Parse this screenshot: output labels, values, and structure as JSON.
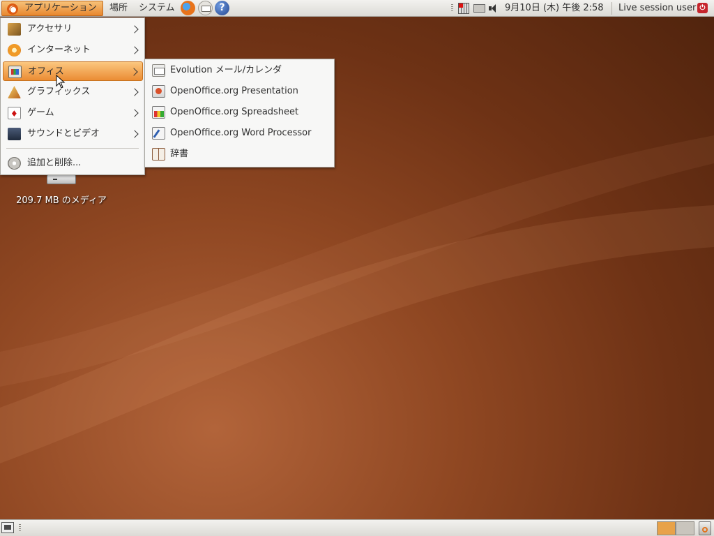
{
  "top_panel": {
    "applications_label": "アプリケーション",
    "places_label": "場所",
    "system_label": "システム",
    "help_glyph": "?",
    "clock": "9月10日 (木) 午後 2:58",
    "user": "Live session user"
  },
  "apps_menu": {
    "items": [
      {
        "label": "アクセサリ",
        "icon": "accessories-icon"
      },
      {
        "label": "インターネット",
        "icon": "internet-icon"
      },
      {
        "label": "オフィス",
        "icon": "office-icon"
      },
      {
        "label": "グラフィックス",
        "icon": "graphics-icon"
      },
      {
        "label": "ゲーム",
        "icon": "games-icon"
      },
      {
        "label": "サウンドとビデオ",
        "icon": "sound-video-icon"
      }
    ],
    "add_remove": "追加と削除..."
  },
  "office_submenu": {
    "items": [
      {
        "label": "Evolution メール/カレンダ",
        "icon": "evolution-icon"
      },
      {
        "label": "OpenOffice.org Presentation",
        "icon": "impress-icon"
      },
      {
        "label": "OpenOffice.org Spreadsheet",
        "icon": "calc-icon"
      },
      {
        "label": "OpenOffice.org Word Processor",
        "icon": "writer-icon"
      },
      {
        "label": "辞書",
        "icon": "dictionary-icon"
      }
    ]
  },
  "desktop": {
    "drive_label": "209.7 MB のメディア"
  },
  "colors": {
    "highlight": "#eb8c34",
    "desktop_base": "#8f4722"
  }
}
